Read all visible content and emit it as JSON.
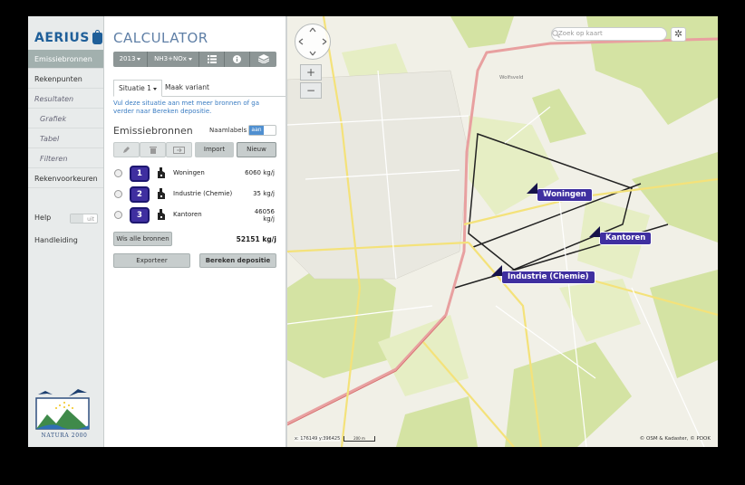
{
  "nav": {
    "logo": "AERIUS",
    "items": [
      {
        "label": "Emissiebronnen",
        "active": true
      },
      {
        "label": "Rekenpunten"
      },
      {
        "label": "Resultaten",
        "kind": "section"
      },
      {
        "label": "Grafiek",
        "kind": "sub"
      },
      {
        "label": "Tabel",
        "kind": "sub"
      },
      {
        "label": "Filteren",
        "kind": "sub"
      },
      {
        "label": "Rekenvoorkeuren"
      }
    ],
    "help_label": "Help",
    "help_toggle": "uit",
    "manual_label": "Handleiding",
    "natura_label": "NATURA 2000"
  },
  "panel": {
    "title": "CALCULATOR",
    "toolbar": {
      "year": "2013",
      "substance": "NH3+NOx",
      "icons": [
        "list-icon",
        "info-icon",
        "layers-icon"
      ]
    },
    "tabs": [
      "Situatie 1",
      "Maak variant"
    ],
    "hint": "Vul deze situatie aan met meer bronnen of ga verder naar Bereken depositie.",
    "section_title": "Emissiebronnen",
    "name_labels": {
      "label": "Naamlabels",
      "value": "aan"
    },
    "actions": {
      "import": "Import",
      "new": "Nieuw"
    },
    "sources": [
      {
        "number": "1",
        "name": "Woningen",
        "value": "6060 kg/j"
      },
      {
        "number": "2",
        "name": "Industrie (Chemie)",
        "value": "35 kg/j"
      },
      {
        "number": "3",
        "name": "Kantoren",
        "value_line1": "46056",
        "value_line2": "kg/j"
      }
    ],
    "clear_all": "Wis alle bronnen",
    "total": "52151 kg/j",
    "export": "Exporteer",
    "calculate": "Bereken depositie"
  },
  "map": {
    "search_placeholder": "Zoek op kaart",
    "place_name": "Wolfsveld",
    "labels": {
      "woningen": "Woningen",
      "kantoren": "Kantoren",
      "industrie": "Industrie (Chemie)"
    },
    "coords": "x: 176149 y:396425",
    "scale": "200 m",
    "attribution": "© OSM & Kadaster, © PDOK",
    "colors": {
      "source_marker": "#3f2fa0",
      "forest": "#cfdf9a",
      "road_main": "#e8a0a0",
      "road_secondary": "#f4e27a"
    }
  }
}
